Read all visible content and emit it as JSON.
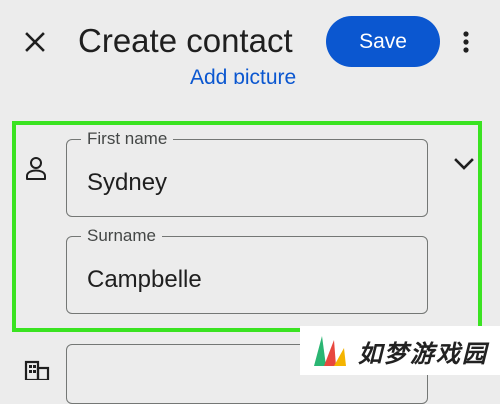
{
  "header": {
    "title": "Create contact",
    "save_label": "Save",
    "close_icon": "close-icon",
    "more_icon": "more-vert-icon"
  },
  "add_picture_label": "Add picture",
  "name_section": {
    "icon": "person-icon",
    "expand_icon": "chevron-down-icon",
    "first_name": {
      "label": "First name",
      "value": "Sydney"
    },
    "surname": {
      "label": "Surname",
      "value": "Campbelle"
    }
  },
  "company_section": {
    "icon": "building-icon"
  },
  "watermark": {
    "text": "如梦游戏园"
  },
  "colors": {
    "accent": "#0b57d0",
    "highlight": "#3ae321",
    "background": "#ececec"
  }
}
